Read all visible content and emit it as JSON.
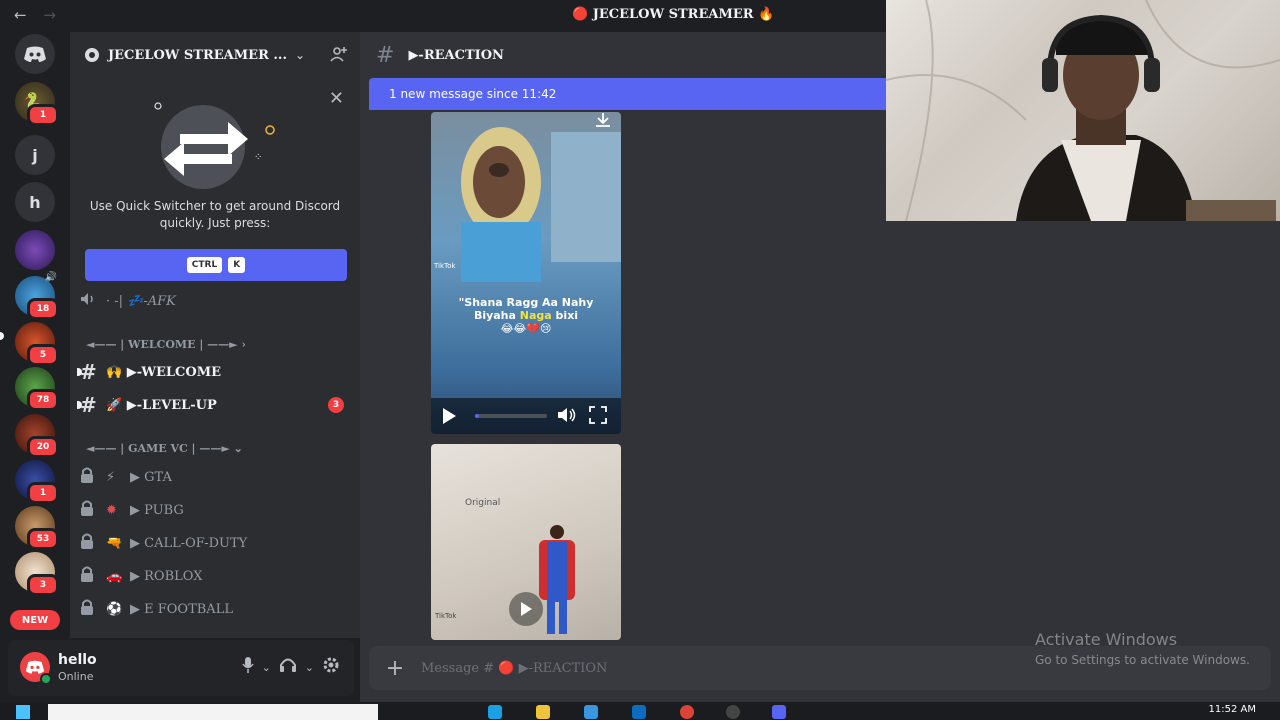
{
  "window": {
    "title": "🔴 JECELOW STREAMER 🔥",
    "back": "←",
    "forward": "→"
  },
  "rail": {
    "items": [
      {
        "label": "j"
      },
      {
        "label": "h"
      }
    ],
    "badges": [
      "1",
      "18",
      "5",
      "78",
      "20",
      "1",
      "53",
      "3"
    ],
    "new_label": "NEW"
  },
  "server": {
    "name": "JECELOW STREAMER ..."
  },
  "quick_switcher": {
    "message": "Use Quick Switcher to get around Discord quickly. Just press:",
    "key1": "CTRL",
    "key2": "K",
    "close": "✕"
  },
  "channels": {
    "afk": "· -| 💤-AFK",
    "category_welcome": "◄—— | WELCOME | ——► ›",
    "welcome": "🙌 ▶-WELCOME",
    "levelup": "🚀 ▶-LEVEL-UP",
    "levelup_badge": "3",
    "category_gamevc": "◄—— | GAME VC | ——► ⌄",
    "voice": [
      {
        "emoji": "⚡",
        "name": "▶ GTA"
      },
      {
        "emoji": "✹",
        "name": "▶ PUBG"
      },
      {
        "emoji": "🔫",
        "name": "▶ CALL-OF-DUTY"
      },
      {
        "emoji": "🚗",
        "name": "▶ ROBLOX"
      },
      {
        "emoji": "⚽",
        "name": "▶ E FOOTBALL"
      }
    ]
  },
  "user": {
    "name": "hello",
    "status": "Online"
  },
  "channel_header": {
    "name": "▶-REACTION"
  },
  "new_messages": "1 new message since 11:42",
  "video1": {
    "caption_line1": "\"Shana Ragg Aa Nahy",
    "caption_line2a": "Biyaha ",
    "caption_highlight": "Naga",
    "caption_line2b": " bixi",
    "caption_emoji": "😂😂💔😢",
    "tiktok": "TikTok",
    "progress": 0.05
  },
  "video2": {
    "overlay_text": "Original",
    "tiktok": "TikTok"
  },
  "composer": {
    "placeholder": "Message # 🔴 ▶-REACTION",
    "plus": "+"
  },
  "watermark": {
    "line1": "Activate Windows",
    "line2": "Go to Settings to activate Windows."
  },
  "taskbar": {
    "time": "11:52 AM"
  },
  "colors": {
    "accent": "#5865f2",
    "danger": "#f23f43",
    "online": "#23a55a"
  }
}
